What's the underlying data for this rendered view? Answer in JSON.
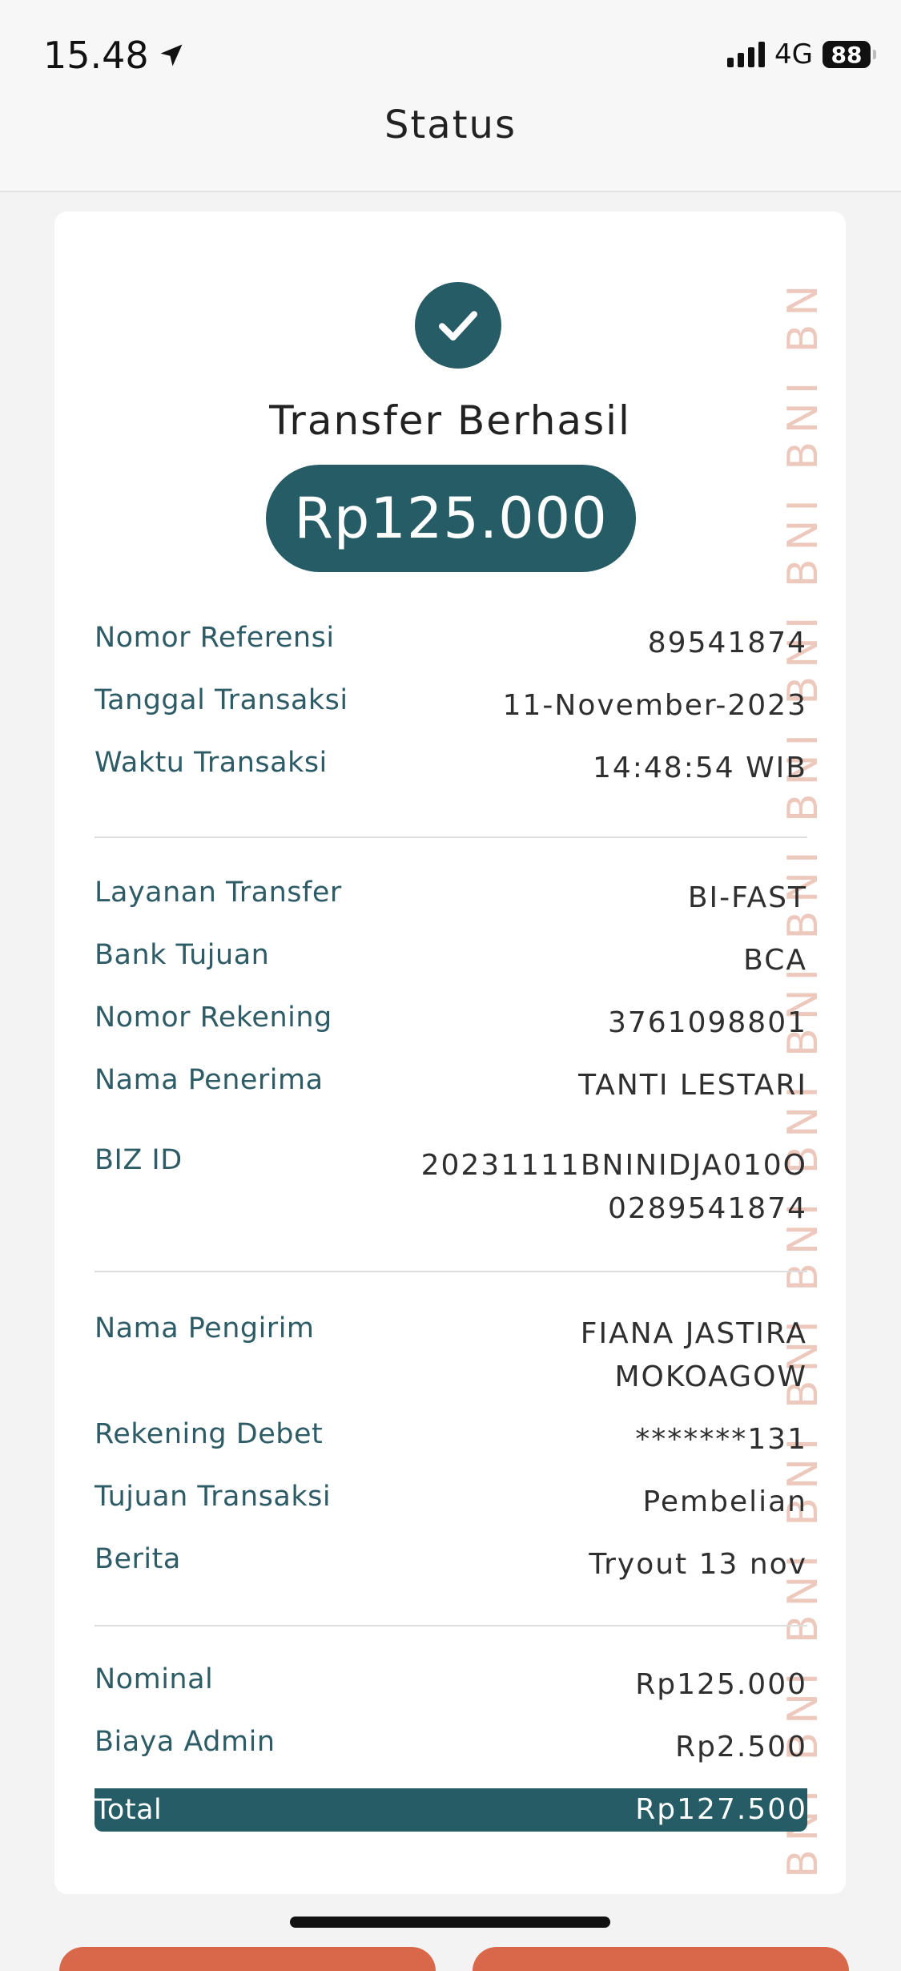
{
  "status_bar": {
    "time": "15.48",
    "network": "4G",
    "battery": "88"
  },
  "header": {
    "title": "Status"
  },
  "receipt": {
    "headline": "Transfer Berhasil",
    "amount": "Rp125.000",
    "watermark": "BNI BNI BNI BNI BNI BNI BNI BNI BNI BNI BNI BNI BNI BNI BNI BNI",
    "group1": [
      {
        "label": "Nomor Referensi",
        "value": "89541874"
      },
      {
        "label": "Tanggal Transaksi",
        "value": "11-November-2023"
      },
      {
        "label": "Waktu Transaksi",
        "value": "14:48:54 WIB"
      }
    ],
    "group2": [
      {
        "label": "Layanan Transfer",
        "value": "BI-FAST"
      },
      {
        "label": "Bank Tujuan",
        "value": "BCA"
      },
      {
        "label": "Nomor Rekening",
        "value": "3761098801"
      },
      {
        "label": "Nama Penerima",
        "value": "TANTI LESTARI"
      },
      {
        "label": "BIZ ID",
        "value_line1": "20231111BNINIDJA010O",
        "value_line2": "0289541874"
      }
    ],
    "group3": [
      {
        "label": "Nama Pengirim",
        "value_line1": "FIANA JASTIRA",
        "value_line2": "MOKOAGOW"
      },
      {
        "label": "Rekening Debet",
        "value": "*******131"
      },
      {
        "label": "Tujuan Transaksi",
        "value": "Pembelian"
      },
      {
        "label": "Berita",
        "value": "Tryout 13 nov"
      }
    ],
    "group4": [
      {
        "label": "Nominal",
        "value": "Rp125.000"
      },
      {
        "label": "Biaya Admin",
        "value": "Rp2.500"
      }
    ],
    "total": {
      "label": "Total",
      "value": "Rp127.500"
    }
  },
  "colors": {
    "primary": "#255c66",
    "label": "#2e5c66",
    "watermark": "#e8b6a8",
    "button": "#d9684a"
  }
}
